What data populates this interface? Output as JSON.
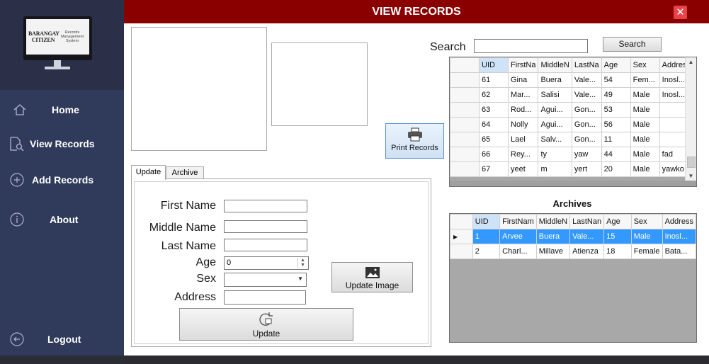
{
  "sidebar": {
    "logo": {
      "brand_line1": "BARANGAY",
      "brand_line2": "CITIZEN",
      "sub_line1": "Records",
      "sub_line2": "Management",
      "sub_line3": "System"
    },
    "items": [
      {
        "label": "Home",
        "icon": "home-icon"
      },
      {
        "label": "View Records",
        "icon": "search-document-icon"
      },
      {
        "label": "Add Records",
        "icon": "plus-circle-icon"
      },
      {
        "label": "About",
        "icon": "info-icon"
      },
      {
        "label": "Logout",
        "icon": "logout-icon"
      }
    ]
  },
  "window": {
    "title": "VIEW RECORDS",
    "close": "✕"
  },
  "search": {
    "label": "Search",
    "value": "",
    "button": "Search"
  },
  "print_button": "Print Records",
  "tabs": [
    "Update",
    "Archive"
  ],
  "form": {
    "first_name": {
      "label": "First Name",
      "value": ""
    },
    "middle_name": {
      "label": "Middle Name",
      "value": ""
    },
    "last_name": {
      "label": "Last Name",
      "value": ""
    },
    "age": {
      "label": "Age",
      "value": "0"
    },
    "sex": {
      "label": "Sex",
      "value": ""
    },
    "address": {
      "label": "Address",
      "value": ""
    },
    "update_image_button": "Update Image",
    "update_button": "Update"
  },
  "records": {
    "columns": [
      "UID",
      "FirstNa",
      "MiddleN",
      "LastNa",
      "Age",
      "Sex",
      "Addres"
    ],
    "rows": [
      [
        "61",
        "Gina",
        "Buera",
        "Vale...",
        "54",
        "Fem...",
        "Inosl..."
      ],
      [
        "62",
        "Mar...",
        "Salisi",
        "Vale...",
        "49",
        "Male",
        "Inosl..."
      ],
      [
        "63",
        "Rod...",
        "Agui...",
        "Gon...",
        "53",
        "Male",
        ""
      ],
      [
        "64",
        "Nolly",
        "Agui...",
        "Gon...",
        "56",
        "Male",
        ""
      ],
      [
        "65",
        "Lael",
        "Salv...",
        "Gon...",
        "11",
        "Male",
        ""
      ],
      [
        "66",
        "Rey...",
        "ty",
        "yaw",
        "44",
        "Male",
        "fad"
      ],
      [
        "67",
        "yeet",
        "m",
        "yert",
        "20",
        "Male",
        "yawko"
      ]
    ]
  },
  "archives": {
    "title": "Archives",
    "columns": [
      "UID",
      "FirstNam",
      "MiddleN",
      "LastNan",
      "Age",
      "Sex",
      "Address"
    ],
    "rows": [
      [
        "1",
        "Arvee",
        "Buera",
        "Vale...",
        "15",
        "Male",
        "Inosl..."
      ],
      [
        "2",
        "Charl...",
        "Millave",
        "Atienza",
        "18",
        "Female",
        "Bata..."
      ]
    ],
    "selected_row": 0
  },
  "colors": {
    "titlebar": "#8a0000",
    "sidebar": "#303b5c",
    "selection": "#3399ff",
    "close": "#e8434b"
  }
}
